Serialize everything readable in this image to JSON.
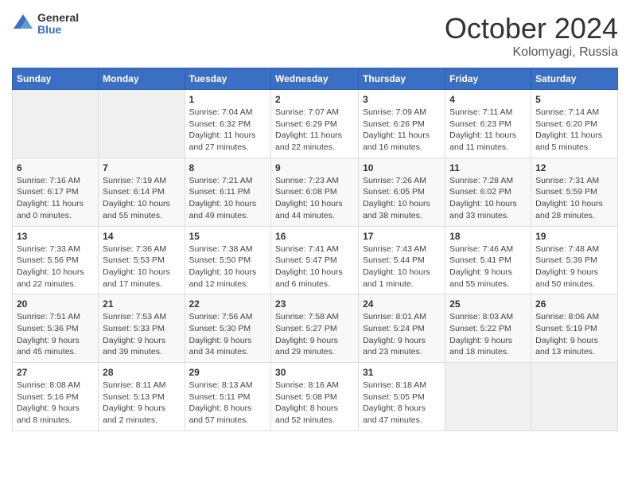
{
  "logo": {
    "general": "General",
    "blue": "Blue"
  },
  "title": {
    "month": "October 2024",
    "location": "Kolomyagi, Russia"
  },
  "weekdays": [
    "Sunday",
    "Monday",
    "Tuesday",
    "Wednesday",
    "Thursday",
    "Friday",
    "Saturday"
  ],
  "weeks": [
    [
      {
        "day": "",
        "sunrise": "",
        "sunset": "",
        "daylight": ""
      },
      {
        "day": "",
        "sunrise": "",
        "sunset": "",
        "daylight": ""
      },
      {
        "day": "1",
        "sunrise": "Sunrise: 7:04 AM",
        "sunset": "Sunset: 6:32 PM",
        "daylight": "Daylight: 11 hours and 27 minutes."
      },
      {
        "day": "2",
        "sunrise": "Sunrise: 7:07 AM",
        "sunset": "Sunset: 6:29 PM",
        "daylight": "Daylight: 11 hours and 22 minutes."
      },
      {
        "day": "3",
        "sunrise": "Sunrise: 7:09 AM",
        "sunset": "Sunset: 6:26 PM",
        "daylight": "Daylight: 11 hours and 16 minutes."
      },
      {
        "day": "4",
        "sunrise": "Sunrise: 7:11 AM",
        "sunset": "Sunset: 6:23 PM",
        "daylight": "Daylight: 11 hours and 11 minutes."
      },
      {
        "day": "5",
        "sunrise": "Sunrise: 7:14 AM",
        "sunset": "Sunset: 6:20 PM",
        "daylight": "Daylight: 11 hours and 5 minutes."
      }
    ],
    [
      {
        "day": "6",
        "sunrise": "Sunrise: 7:16 AM",
        "sunset": "Sunset: 6:17 PM",
        "daylight": "Daylight: 11 hours and 0 minutes."
      },
      {
        "day": "7",
        "sunrise": "Sunrise: 7:19 AM",
        "sunset": "Sunset: 6:14 PM",
        "daylight": "Daylight: 10 hours and 55 minutes."
      },
      {
        "day": "8",
        "sunrise": "Sunrise: 7:21 AM",
        "sunset": "Sunset: 6:11 PM",
        "daylight": "Daylight: 10 hours and 49 minutes."
      },
      {
        "day": "9",
        "sunrise": "Sunrise: 7:23 AM",
        "sunset": "Sunset: 6:08 PM",
        "daylight": "Daylight: 10 hours and 44 minutes."
      },
      {
        "day": "10",
        "sunrise": "Sunrise: 7:26 AM",
        "sunset": "Sunset: 6:05 PM",
        "daylight": "Daylight: 10 hours and 38 minutes."
      },
      {
        "day": "11",
        "sunrise": "Sunrise: 7:28 AM",
        "sunset": "Sunset: 6:02 PM",
        "daylight": "Daylight: 10 hours and 33 minutes."
      },
      {
        "day": "12",
        "sunrise": "Sunrise: 7:31 AM",
        "sunset": "Sunset: 5:59 PM",
        "daylight": "Daylight: 10 hours and 28 minutes."
      }
    ],
    [
      {
        "day": "13",
        "sunrise": "Sunrise: 7:33 AM",
        "sunset": "Sunset: 5:56 PM",
        "daylight": "Daylight: 10 hours and 22 minutes."
      },
      {
        "day": "14",
        "sunrise": "Sunrise: 7:36 AM",
        "sunset": "Sunset: 5:53 PM",
        "daylight": "Daylight: 10 hours and 17 minutes."
      },
      {
        "day": "15",
        "sunrise": "Sunrise: 7:38 AM",
        "sunset": "Sunset: 5:50 PM",
        "daylight": "Daylight: 10 hours and 12 minutes."
      },
      {
        "day": "16",
        "sunrise": "Sunrise: 7:41 AM",
        "sunset": "Sunset: 5:47 PM",
        "daylight": "Daylight: 10 hours and 6 minutes."
      },
      {
        "day": "17",
        "sunrise": "Sunrise: 7:43 AM",
        "sunset": "Sunset: 5:44 PM",
        "daylight": "Daylight: 10 hours and 1 minute."
      },
      {
        "day": "18",
        "sunrise": "Sunrise: 7:46 AM",
        "sunset": "Sunset: 5:41 PM",
        "daylight": "Daylight: 9 hours and 55 minutes."
      },
      {
        "day": "19",
        "sunrise": "Sunrise: 7:48 AM",
        "sunset": "Sunset: 5:39 PM",
        "daylight": "Daylight: 9 hours and 50 minutes."
      }
    ],
    [
      {
        "day": "20",
        "sunrise": "Sunrise: 7:51 AM",
        "sunset": "Sunset: 5:36 PM",
        "daylight": "Daylight: 9 hours and 45 minutes."
      },
      {
        "day": "21",
        "sunrise": "Sunrise: 7:53 AM",
        "sunset": "Sunset: 5:33 PM",
        "daylight": "Daylight: 9 hours and 39 minutes."
      },
      {
        "day": "22",
        "sunrise": "Sunrise: 7:56 AM",
        "sunset": "Sunset: 5:30 PM",
        "daylight": "Daylight: 9 hours and 34 minutes."
      },
      {
        "day": "23",
        "sunrise": "Sunrise: 7:58 AM",
        "sunset": "Sunset: 5:27 PM",
        "daylight": "Daylight: 9 hours and 29 minutes."
      },
      {
        "day": "24",
        "sunrise": "Sunrise: 8:01 AM",
        "sunset": "Sunset: 5:24 PM",
        "daylight": "Daylight: 9 hours and 23 minutes."
      },
      {
        "day": "25",
        "sunrise": "Sunrise: 8:03 AM",
        "sunset": "Sunset: 5:22 PM",
        "daylight": "Daylight: 9 hours and 18 minutes."
      },
      {
        "day": "26",
        "sunrise": "Sunrise: 8:06 AM",
        "sunset": "Sunset: 5:19 PM",
        "daylight": "Daylight: 9 hours and 13 minutes."
      }
    ],
    [
      {
        "day": "27",
        "sunrise": "Sunrise: 8:08 AM",
        "sunset": "Sunset: 5:16 PM",
        "daylight": "Daylight: 9 hours and 8 minutes."
      },
      {
        "day": "28",
        "sunrise": "Sunrise: 8:11 AM",
        "sunset": "Sunset: 5:13 PM",
        "daylight": "Daylight: 9 hours and 2 minutes."
      },
      {
        "day": "29",
        "sunrise": "Sunrise: 8:13 AM",
        "sunset": "Sunset: 5:11 PM",
        "daylight": "Daylight: 8 hours and 57 minutes."
      },
      {
        "day": "30",
        "sunrise": "Sunrise: 8:16 AM",
        "sunset": "Sunset: 5:08 PM",
        "daylight": "Daylight: 8 hours and 52 minutes."
      },
      {
        "day": "31",
        "sunrise": "Sunrise: 8:18 AM",
        "sunset": "Sunset: 5:05 PM",
        "daylight": "Daylight: 8 hours and 47 minutes."
      },
      {
        "day": "",
        "sunrise": "",
        "sunset": "",
        "daylight": ""
      },
      {
        "day": "",
        "sunrise": "",
        "sunset": "",
        "daylight": ""
      }
    ]
  ]
}
